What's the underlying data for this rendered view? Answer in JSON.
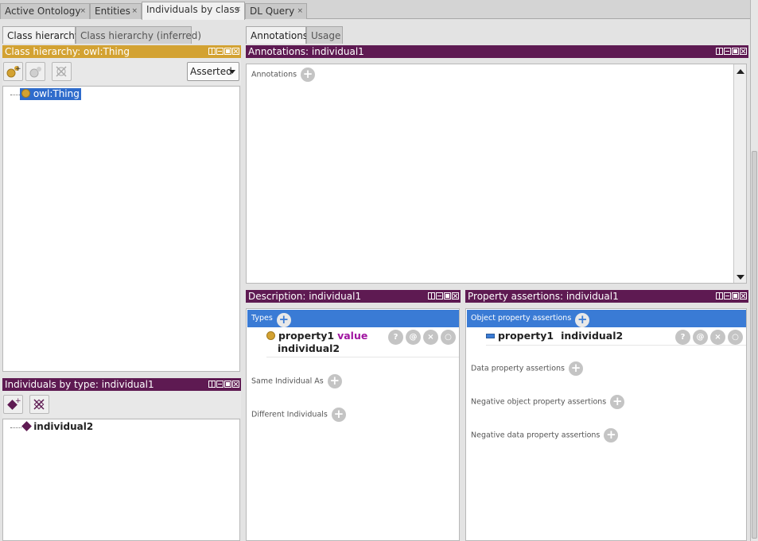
{
  "top_tabs": [
    {
      "label": "Active Ontology",
      "close": "×"
    },
    {
      "label": "Entities",
      "close": "×"
    },
    {
      "label": "Individuals by class",
      "close": "×"
    },
    {
      "label": "DL Query",
      "close": "×"
    }
  ],
  "left_tabs": [
    "Class hierarchy",
    "Class hierarchy (inferred)"
  ],
  "class_hierarchy": {
    "title": "Class hierarchy: owl:Thing",
    "dropdown": "Asserted",
    "tree_root": "owl:Thing"
  },
  "individuals_by_type": {
    "title": "Individuals by type: individual1",
    "items": [
      "individual2"
    ]
  },
  "right_tabs": [
    "Annotations",
    "Usage"
  ],
  "annotations": {
    "title": "Annotations: individual1",
    "section_label": "Annotations"
  },
  "description": {
    "title": "Description: individual1",
    "types_label": "Types",
    "type_expr": {
      "property": "property1",
      "keyword": "value",
      "target": "individual2"
    },
    "same_individual_label": "Same Individual As",
    "different_individuals_label": "Different Individuals"
  },
  "property_assertions": {
    "title": "Property assertions: individual1",
    "object_label": "Object property assertions",
    "object_item": {
      "property": "property1",
      "target": "individual2"
    },
    "data_label": "Data property assertions",
    "neg_object_label": "Negative object property assertions",
    "neg_data_label": "Negative data property assertions"
  },
  "row_buttons": [
    "?",
    "@",
    "×",
    "○"
  ],
  "plus": "+",
  "colors": {
    "gold": "#d3a232",
    "purple": "#5e1a52",
    "blue": "#3a7bd5",
    "keyword": "#a015a0"
  }
}
